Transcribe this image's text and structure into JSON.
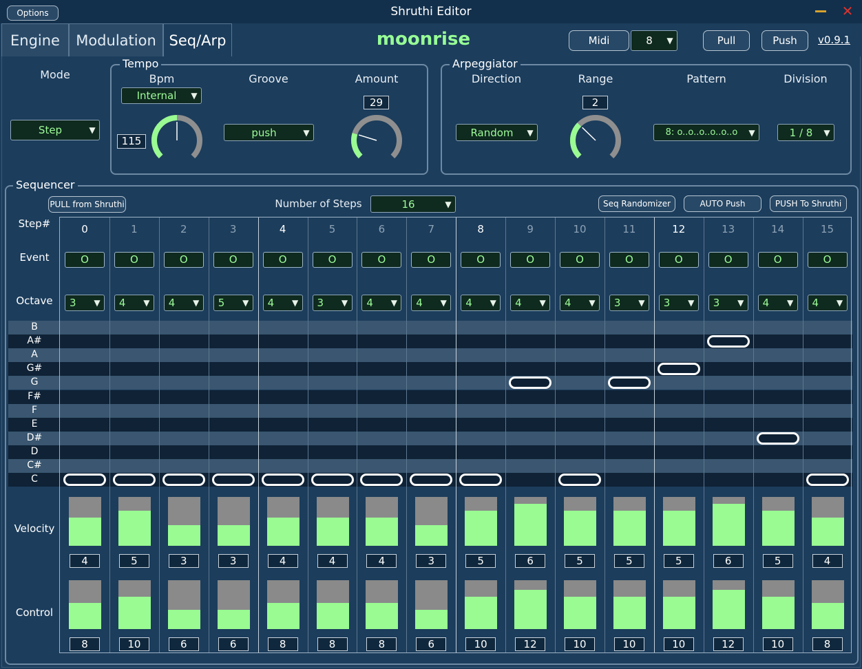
{
  "window": {
    "title": "Shruthi Editor",
    "options_label": "Options"
  },
  "tabs": [
    {
      "label": "Engine",
      "active": false
    },
    {
      "label": "Modulation",
      "active": false
    },
    {
      "label": "Seq/Arp",
      "active": true
    }
  ],
  "header": {
    "preset_name": "moonrise",
    "midi_label": "Midi",
    "midi_channel": "8",
    "pull_label": "Pull",
    "push_label": "Push",
    "version": "v0.9.1"
  },
  "mode": {
    "label": "Mode",
    "value": "Step"
  },
  "tempo": {
    "title": "Tempo",
    "bpm_label": "Bpm",
    "bpm_source": "Internal",
    "bpm_value": "115",
    "bpm_knob_fraction": 0.5,
    "groove_label": "Groove",
    "groove_value": "push",
    "amount_label": "Amount",
    "amount_value": "29",
    "amount_knob_fraction": 0.23
  },
  "arpeggiator": {
    "title": "Arpeggiator",
    "direction_label": "Direction",
    "direction_value": "Random",
    "range_label": "Range",
    "range_value": "2",
    "range_knob_fraction": 0.33,
    "pattern_label": "Pattern",
    "pattern_value": "8: o..o..o..o..o..o",
    "division_label": "Division",
    "division_value": "1 / 8"
  },
  "sequencer": {
    "title": "Sequencer",
    "pull_button": "PULL from Shruthi",
    "steps_label": "Number of Steps",
    "steps_value": "16",
    "randomizer_button": "Seq Randomizer",
    "auto_push_button": "AUTO Push",
    "push_button": "PUSH To Shruthi",
    "row_labels": {
      "step": "Step#",
      "event": "Event",
      "octave": "Octave",
      "velocity": "Velocity",
      "control": "Control"
    },
    "notes": [
      "B",
      "A#",
      "A",
      "G#",
      "G",
      "F#",
      "F",
      "E",
      "D#",
      "D",
      "C#",
      "C"
    ],
    "velocity_max": 7,
    "control_max": 15,
    "steps": [
      {
        "num": "0",
        "event": "O",
        "octave": "3",
        "note": "C",
        "velocity": "4",
        "control": "8"
      },
      {
        "num": "1",
        "event": "O",
        "octave": "4",
        "note": "C",
        "velocity": "5",
        "control": "10"
      },
      {
        "num": "2",
        "event": "O",
        "octave": "4",
        "note": "C",
        "velocity": "3",
        "control": "6"
      },
      {
        "num": "3",
        "event": "O",
        "octave": "5",
        "note": "C",
        "velocity": "3",
        "control": "6"
      },
      {
        "num": "4",
        "event": "O",
        "octave": "4",
        "note": "C",
        "velocity": "4",
        "control": "8"
      },
      {
        "num": "5",
        "event": "O",
        "octave": "3",
        "note": "C",
        "velocity": "4",
        "control": "8"
      },
      {
        "num": "6",
        "event": "O",
        "octave": "4",
        "note": "C",
        "velocity": "4",
        "control": "8"
      },
      {
        "num": "7",
        "event": "O",
        "octave": "4",
        "note": "C",
        "velocity": "3",
        "control": "6"
      },
      {
        "num": "8",
        "event": "O",
        "octave": "4",
        "note": "C",
        "velocity": "5",
        "control": "10"
      },
      {
        "num": "9",
        "event": "O",
        "octave": "4",
        "note": "G",
        "velocity": "6",
        "control": "12"
      },
      {
        "num": "10",
        "event": "O",
        "octave": "4",
        "note": "C",
        "velocity": "5",
        "control": "10"
      },
      {
        "num": "11",
        "event": "O",
        "octave": "3",
        "note": "G",
        "velocity": "5",
        "control": "10"
      },
      {
        "num": "12",
        "event": "O",
        "octave": "3",
        "note": "G#",
        "velocity": "5",
        "control": "10"
      },
      {
        "num": "13",
        "event": "O",
        "octave": "3",
        "note": "A#",
        "velocity": "6",
        "control": "12"
      },
      {
        "num": "14",
        "event": "O",
        "octave": "4",
        "note": "D#",
        "velocity": "5",
        "control": "10"
      },
      {
        "num": "15",
        "event": "O",
        "octave": "4",
        "note": "C",
        "velocity": "4",
        "control": "8"
      }
    ]
  },
  "colors": {
    "accent_green": "#97ff95",
    "panel_bg": "#1c3d5c",
    "bar_fill": "#99fb92",
    "bar_track": "#8a8a8a"
  }
}
